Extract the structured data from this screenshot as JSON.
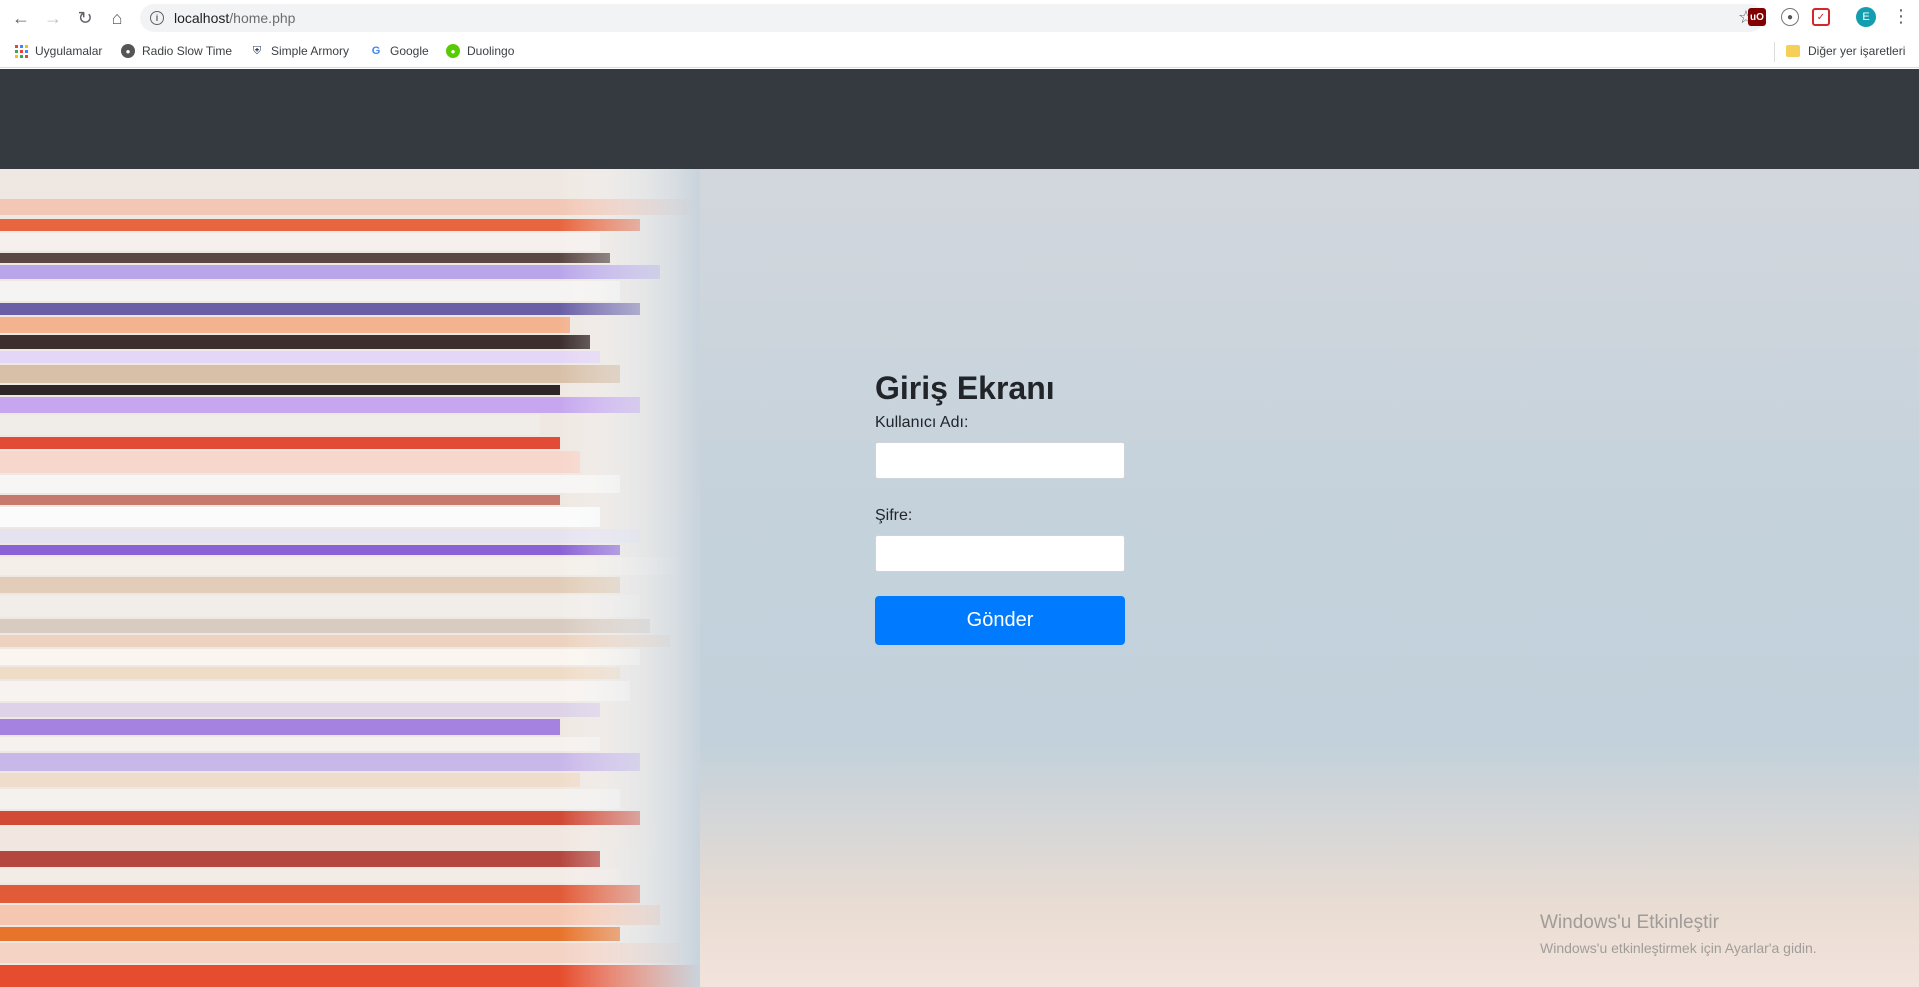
{
  "browser": {
    "url_host": "localhost",
    "url_path": "/home.php",
    "profile_initial": "E"
  },
  "bookmarks": {
    "items": [
      "Uygulamalar",
      "Radio Slow Time",
      "Simple Armory",
      "Google",
      "Duolingo"
    ],
    "other": "Diğer yer işaretleri"
  },
  "login": {
    "title": "Giriş Ekranı",
    "username_label": "Kullanıcı Adı:",
    "username_value": "",
    "password_label": "Şifre:",
    "password_value": "",
    "submit_label": "Gönder"
  },
  "watermark": {
    "line1": "Windows'u Etkinleştir",
    "line2": "Windows'u etkinleştirmek için Ayarlar'a gidin."
  },
  "colors": {
    "navbar": "#343a40",
    "primary": "#007bff"
  }
}
